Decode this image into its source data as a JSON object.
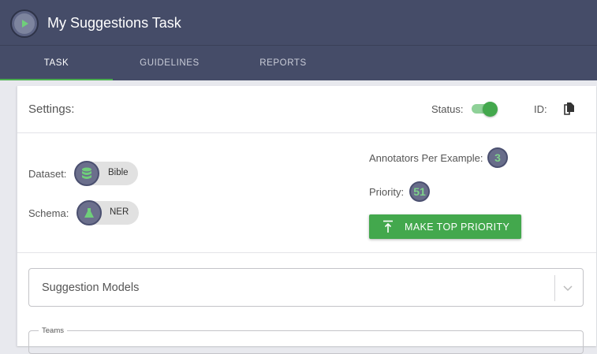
{
  "app": {
    "title": "My Suggestions Task"
  },
  "tabs": [
    {
      "label": "TASK",
      "active": true
    },
    {
      "label": "GUIDELINES",
      "active": false
    },
    {
      "label": "REPORTS",
      "active": false
    }
  ],
  "settings": {
    "heading": "Settings:",
    "status_label": "Status:",
    "status_on": true,
    "id_label": "ID:"
  },
  "details": {
    "dataset_label": "Dataset:",
    "dataset_value": "Bible",
    "dataset_icon": "database-icon",
    "schema_label": "Schema:",
    "schema_value": "NER",
    "schema_icon": "flask-icon",
    "annotators_label": "Annotators Per Example:",
    "annotators_value": "3",
    "priority_label": "Priority:",
    "priority_value": "51",
    "make_top_priority_label": "MAKE TOP PRIORITY"
  },
  "suggestion_models": {
    "placeholder": "Suggestion Models"
  },
  "teams": {
    "label": "Teams"
  },
  "colors": {
    "appbar": "#454c68",
    "accent_green": "#43a84d",
    "badge_text": "#7ed38a"
  }
}
